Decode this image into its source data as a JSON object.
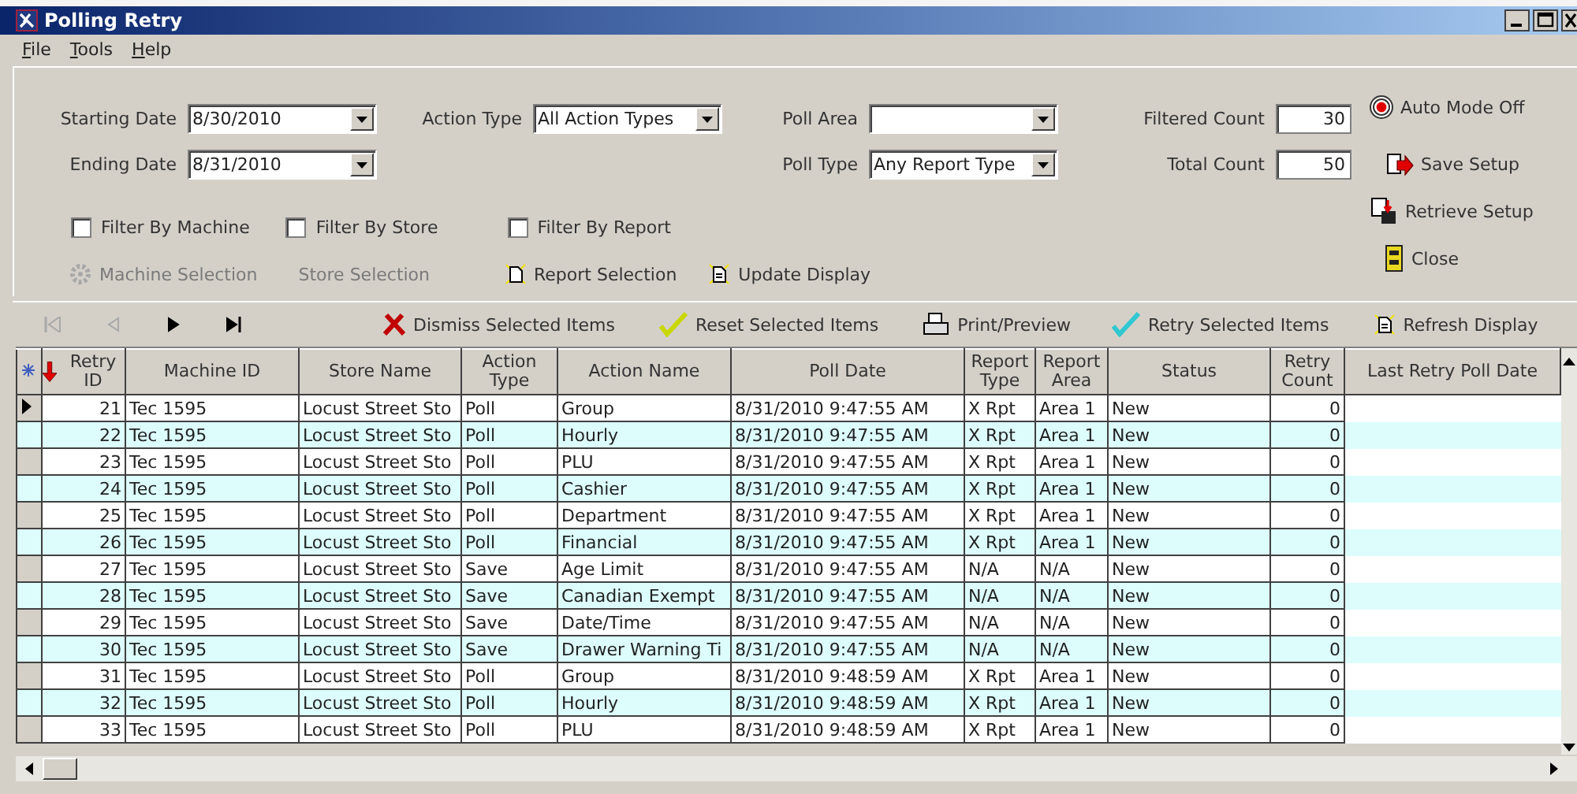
{
  "window": {
    "title": "Polling Retry"
  },
  "menu": [
    "File",
    "Tools",
    "Help"
  ],
  "filters": {
    "starting_date": {
      "label": "Starting Date",
      "value": "8/30/2010"
    },
    "ending_date": {
      "label": "Ending Date",
      "value": "8/31/2010"
    },
    "action_type": {
      "label": "Action Type",
      "value": "All Action Types"
    },
    "poll_area": {
      "label": "Poll Area"
    },
    "poll_type": {
      "label": "Poll Type",
      "value": "Any Report Type"
    },
    "filtered_count": {
      "label": "Filtered Count",
      "value": "30"
    },
    "total_count": {
      "label": "Total Count",
      "value": "50"
    }
  },
  "checkboxes": [
    {
      "label": "Filter By Machine",
      "checked": false
    },
    {
      "label": "Filter By Store",
      "checked": false
    },
    {
      "label": "Filter By Report",
      "checked": false
    }
  ],
  "selection_buttons": [
    {
      "label": "Machine Selection",
      "kind": "machine",
      "disabled": true
    },
    {
      "label": "Store Selection",
      "kind": "none",
      "disabled": true
    },
    {
      "label": "Report Selection",
      "kind": "page",
      "disabled": false
    },
    {
      "label": "Update Display",
      "kind": "doc",
      "disabled": false
    }
  ],
  "side_buttons": [
    {
      "label": "Auto Mode Off",
      "kind": "target"
    },
    {
      "label": "Save Setup",
      "kind": "save"
    },
    {
      "label": "Retrieve Setup",
      "kind": "retrieve"
    },
    {
      "label": "Close",
      "kind": "close"
    }
  ],
  "navigator": [
    {
      "kind": "first",
      "disabled": true
    },
    {
      "kind": "prev",
      "disabled": true
    },
    {
      "kind": "next",
      "disabled": false
    },
    {
      "kind": "last",
      "disabled": false
    }
  ],
  "toolbar": [
    {
      "label": "Dismiss Selected Items",
      "kind": "dismiss"
    },
    {
      "label": "Reset Selected Items",
      "kind": "reset"
    },
    {
      "label": "Print/Preview",
      "kind": "print"
    },
    {
      "label": "Retry Selected Items",
      "kind": "retry"
    },
    {
      "label": "Refresh Display",
      "kind": "refresh"
    }
  ],
  "table": {
    "columns": [
      {
        "label": "Retry ID",
        "sorted_descending": true
      },
      {
        "label": "Machine ID"
      },
      {
        "label": "Store Name"
      },
      {
        "label": "Action Type"
      },
      {
        "label": "Action Name"
      },
      {
        "label": "Poll Date"
      },
      {
        "label": "Report Type"
      },
      {
        "label": "Report Area"
      },
      {
        "label": "Status"
      },
      {
        "label": "Retry Count"
      },
      {
        "label": "Last Retry Poll Date"
      }
    ],
    "rows": [
      {
        "selected": true,
        "cells": [
          "21",
          "Tec 1595",
          "Locust Street Sto",
          "Poll",
          "Group",
          "8/31/2010 9:47:55 AM",
          "X Rpt",
          "Area 1",
          "New",
          "0"
        ]
      },
      {
        "selected": false,
        "cells": [
          "22",
          "Tec 1595",
          "Locust Street Sto",
          "Poll",
          "Hourly",
          "8/31/2010 9:47:55 AM",
          "X Rpt",
          "Area 1",
          "New",
          "0"
        ]
      },
      {
        "selected": false,
        "cells": [
          "23",
          "Tec 1595",
          "Locust Street Sto",
          "Poll",
          "PLU",
          "8/31/2010 9:47:55 AM",
          "X Rpt",
          "Area 1",
          "New",
          "0"
        ]
      },
      {
        "selected": false,
        "cells": [
          "24",
          "Tec 1595",
          "Locust Street Sto",
          "Poll",
          "Cashier",
          "8/31/2010 9:47:55 AM",
          "X Rpt",
          "Area 1",
          "New",
          "0"
        ]
      },
      {
        "selected": false,
        "cells": [
          "25",
          "Tec 1595",
          "Locust Street Sto",
          "Poll",
          "Department",
          "8/31/2010 9:47:55 AM",
          "X Rpt",
          "Area 1",
          "New",
          "0"
        ]
      },
      {
        "selected": false,
        "cells": [
          "26",
          "Tec 1595",
          "Locust Street Sto",
          "Poll",
          "Financial",
          "8/31/2010 9:47:55 AM",
          "X Rpt",
          "Area 1",
          "New",
          "0"
        ]
      },
      {
        "selected": false,
        "cells": [
          "27",
          "Tec 1595",
          "Locust Street Sto",
          "Save",
          "Age Limit",
          "8/31/2010 9:47:55 AM",
          "N/A",
          "N/A",
          "New",
          "0"
        ]
      },
      {
        "selected": false,
        "cells": [
          "28",
          "Tec 1595",
          "Locust Street Sto",
          "Save",
          "Canadian Exempt",
          "8/31/2010 9:47:55 AM",
          "N/A",
          "N/A",
          "New",
          "0"
        ]
      },
      {
        "selected": false,
        "cells": [
          "29",
          "Tec 1595",
          "Locust Street Sto",
          "Save",
          "Date/Time",
          "8/31/2010 9:47:55 AM",
          "N/A",
          "N/A",
          "New",
          "0"
        ]
      },
      {
        "selected": false,
        "cells": [
          "30",
          "Tec 1595",
          "Locust Street Sto",
          "Save",
          "Drawer Warning Ti",
          "8/31/2010 9:47:55 AM",
          "N/A",
          "N/A",
          "New",
          "0"
        ]
      },
      {
        "selected": false,
        "cells": [
          "31",
          "Tec 1595",
          "Locust Street Sto",
          "Poll",
          "Group",
          "8/31/2010 9:48:59 AM",
          "X Rpt",
          "Area 1",
          "New",
          "0"
        ]
      },
      {
        "selected": false,
        "cells": [
          "32",
          "Tec 1595",
          "Locust Street Sto",
          "Poll",
          "Hourly",
          "8/31/2010 9:48:59 AM",
          "X Rpt",
          "Area 1",
          "New",
          "0"
        ]
      },
      {
        "selected": false,
        "cells": [
          "33",
          "Tec 1595",
          "Locust Street Sto",
          "Poll",
          "PLU",
          "8/31/2010 9:48:59 AM",
          "X Rpt",
          "Area 1",
          "New",
          "0"
        ]
      }
    ]
  }
}
